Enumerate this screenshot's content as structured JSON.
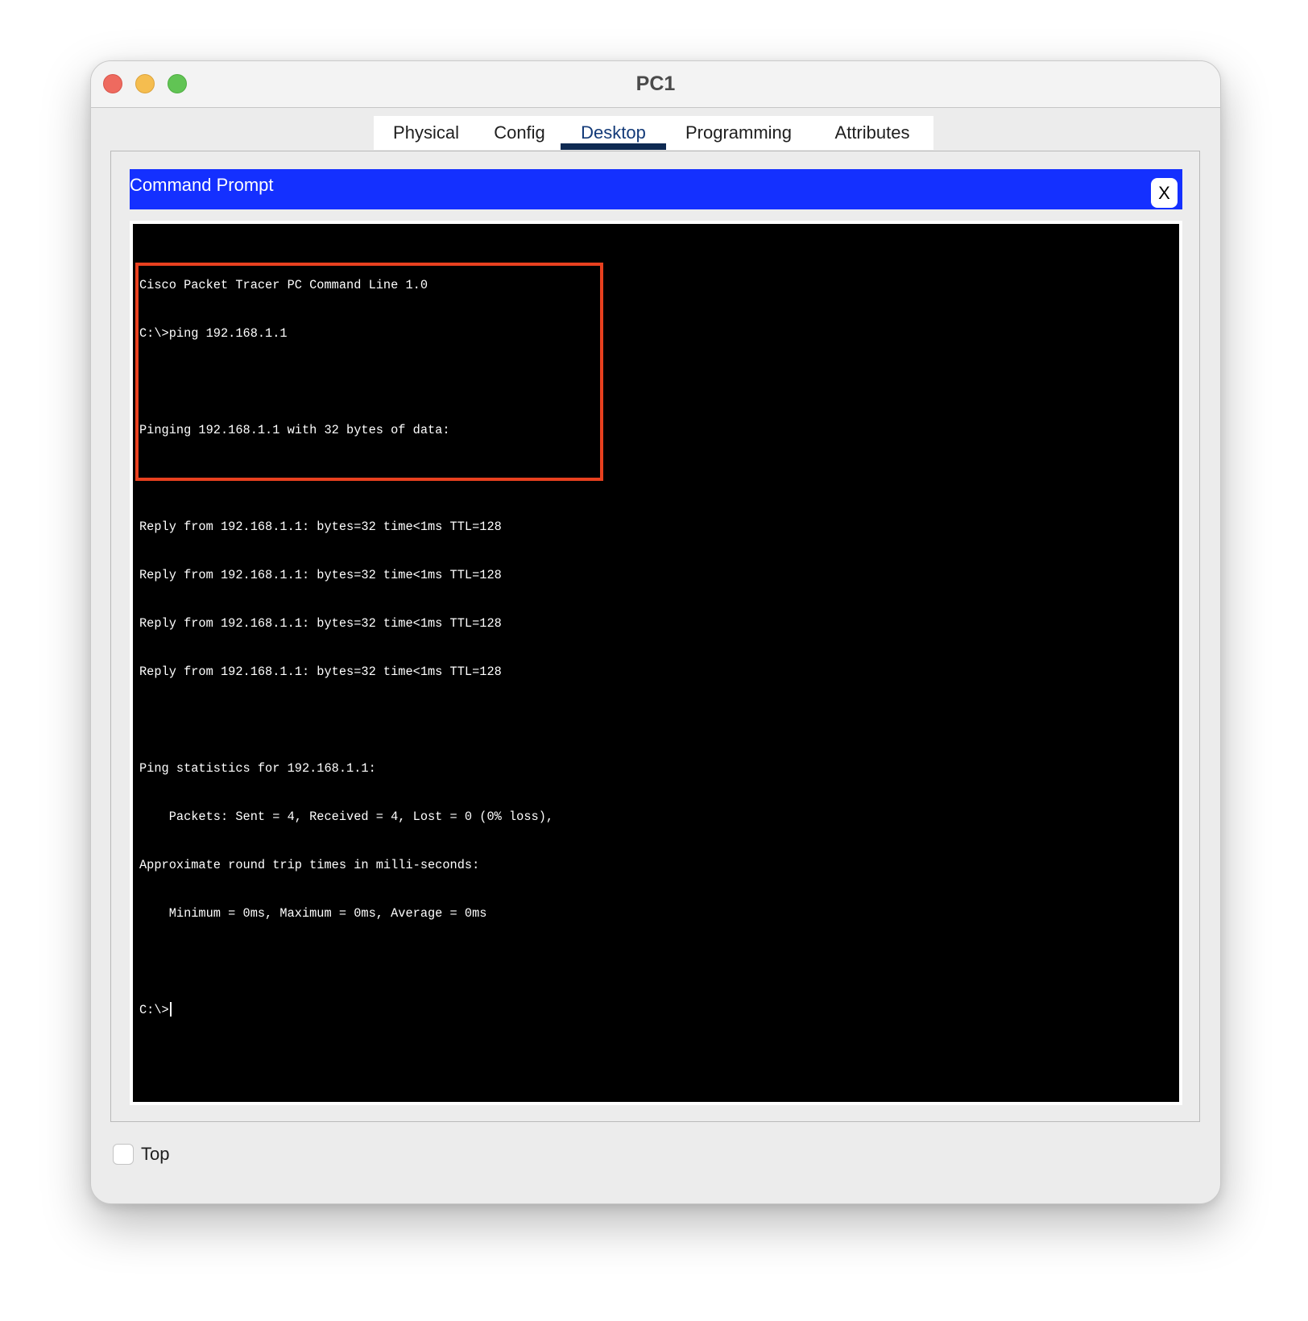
{
  "window": {
    "title": "PC1"
  },
  "tabs": [
    {
      "label": "Physical",
      "active": false
    },
    {
      "label": "Config",
      "active": false
    },
    {
      "label": "Desktop",
      "active": true
    },
    {
      "label": "Programming",
      "active": false
    },
    {
      "label": "Attributes",
      "active": false
    }
  ],
  "command_prompt": {
    "title": "Command Prompt",
    "close_label": "X"
  },
  "terminal": {
    "lines": [
      "Cisco Packet Tracer PC Command Line 1.0",
      "C:\\>ping 192.168.1.1",
      "",
      "Pinging 192.168.1.1 with 32 bytes of data:",
      "",
      "Reply from 192.168.1.1: bytes=32 time<1ms TTL=128",
      "Reply from 192.168.1.1: bytes=32 time<1ms TTL=128",
      "Reply from 192.168.1.1: bytes=32 time<1ms TTL=128",
      "Reply from 192.168.1.1: bytes=32 time<1ms TTL=128",
      "",
      "Ping statistics for 192.168.1.1:",
      "    Packets: Sent = 4, Received = 4, Lost = 0 (0% loss),",
      "Approximate round trip times in milli-seconds:",
      "    Minimum = 0ms, Maximum = 0ms, Average = 0ms",
      ""
    ],
    "prompt": "C:\\>"
  },
  "footer": {
    "top_label": "Top",
    "top_checked": false
  },
  "colors": {
    "header_blue": "#1430ff",
    "highlight": "#e8401f",
    "tab_active": "#0f2a52"
  }
}
